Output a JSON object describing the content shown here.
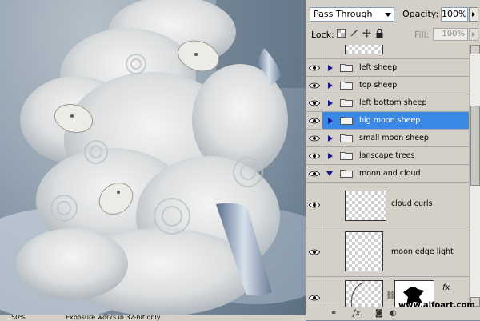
{
  "colors": {
    "selected_row": "#3a89e6",
    "panel_bg": "#d4d0c8"
  },
  "layers_panel": {
    "blend_mode": "Pass Through",
    "opacity_label": "Opacity:",
    "opacity_value": "100%",
    "lock_label": "Lock:",
    "lock_icons": [
      "lock-transparent-icon",
      "lock-brush-icon",
      "lock-move-icon",
      "lock-all-icon"
    ],
    "fill_label": "Fill:",
    "fill_value": "100%",
    "groups": [
      {
        "name": "left sheep",
        "expanded": false,
        "selected": false
      },
      {
        "name": "top sheep",
        "expanded": false,
        "selected": false
      },
      {
        "name": "left bottom sheep",
        "expanded": false,
        "selected": false
      },
      {
        "name": "big moon sheep",
        "expanded": false,
        "selected": true
      },
      {
        "name": "small moon sheep",
        "expanded": false,
        "selected": false
      },
      {
        "name": "lanscape trees",
        "expanded": false,
        "selected": false
      },
      {
        "name": "moon and cloud",
        "expanded": true,
        "selected": false
      }
    ],
    "layers": [
      {
        "name": "cloud curls"
      },
      {
        "name": "moon edge light"
      },
      {
        "name": "",
        "fx": "fx"
      }
    ],
    "bottom_icons": [
      "link-icon",
      "fx-icon",
      "mask-icon",
      "adjustment-icon",
      "folder-icon",
      "new-layer-icon",
      "trash-icon"
    ]
  },
  "status_bar": {
    "zoom": "50%",
    "info": "Exposure works in 32-bit only"
  },
  "watermark": "www.alfoart.com"
}
